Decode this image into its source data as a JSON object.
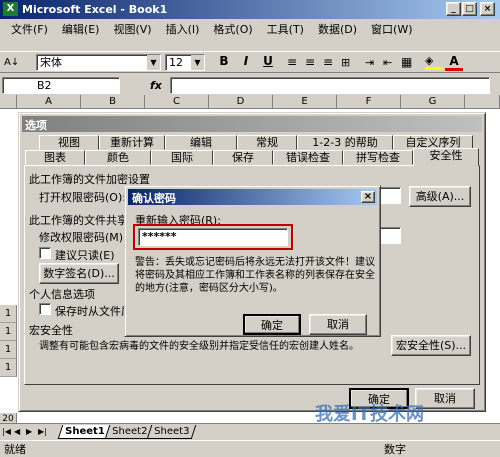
{
  "titlebar": {
    "title": "Microsoft Excel - Book1"
  },
  "menubar": {
    "items": [
      "文件(F)",
      "编辑(E)",
      "视图(V)",
      "插入(I)",
      "格式(O)",
      "工具(T)",
      "数据(D)",
      "窗口(W)"
    ]
  },
  "toolbar": {
    "font_name": "宋体",
    "font_size": "12",
    "bold": "B",
    "italic": "I",
    "underline": "U",
    "font_color_label": "A"
  },
  "formula_bar": {
    "cell_ref": "B2",
    "fx": "fx"
  },
  "grid": {
    "columns": [
      "A",
      "B",
      "C",
      "D",
      "E",
      "F",
      "G"
    ],
    "rows": [
      "1",
      "1",
      "1",
      "1",
      "1",
      "1",
      "1",
      "1",
      "1",
      "1",
      "20"
    ]
  },
  "sheet_tabs": [
    "Sheet1",
    "Sheet2",
    "Sheet3"
  ],
  "statusbar": {
    "left": "就绪",
    "right": "数字"
  },
  "options_dialog": {
    "title": "选项",
    "tabs_row1": [
      "视图",
      "重新计算",
      "编辑",
      "常规",
      "1-2-3 的帮助",
      "自定义序列"
    ],
    "tabs_row2": [
      "图表",
      "颜色",
      "国际",
      "保存",
      "错误检查",
      "拼写检查",
      "安全性"
    ],
    "section_encrypt": "此工作簿的文件加密设置",
    "open_password_label": "打开权限密码(O):",
    "advanced_button": "高级(A)...",
    "section_share": "此工作簿的文件共享设",
    "modify_password_label": "修改权限密码(M):",
    "readonly_label": "建议只读(E)",
    "digital_signature_button": "数字签名(D)...",
    "section_privacy": "个人信息选项",
    "remove_personal_label": "保存时从文件属性",
    "section_macro": "宏安全性",
    "macro_text": "调整有可能包含宏病毒的文件的安全级别并指定受信任的宏创建人姓名。",
    "macro_security_button": "宏安全性(S)...",
    "ok_button": "确定",
    "cancel_button": "取消"
  },
  "confirm_dialog": {
    "title": "确认密码",
    "reenter_label": "重新输入密码(R):",
    "password_value": "******",
    "warning_text": "警告：丢失或忘记密码后将永远无法打开该文件！建议将密码及其相应工作簿和工作表名称的列表保存在安全的地方(注意，密码区分大小写)。",
    "ok_button": "确定",
    "cancel_button": "取消",
    "close_glyph": "×"
  },
  "watermark": {
    "text": "我爱IT技术网"
  },
  "colors": {
    "titlebar": "#0a246a",
    "highlight_box": "#c00000",
    "dialog_bg": "#d4d0c8"
  }
}
